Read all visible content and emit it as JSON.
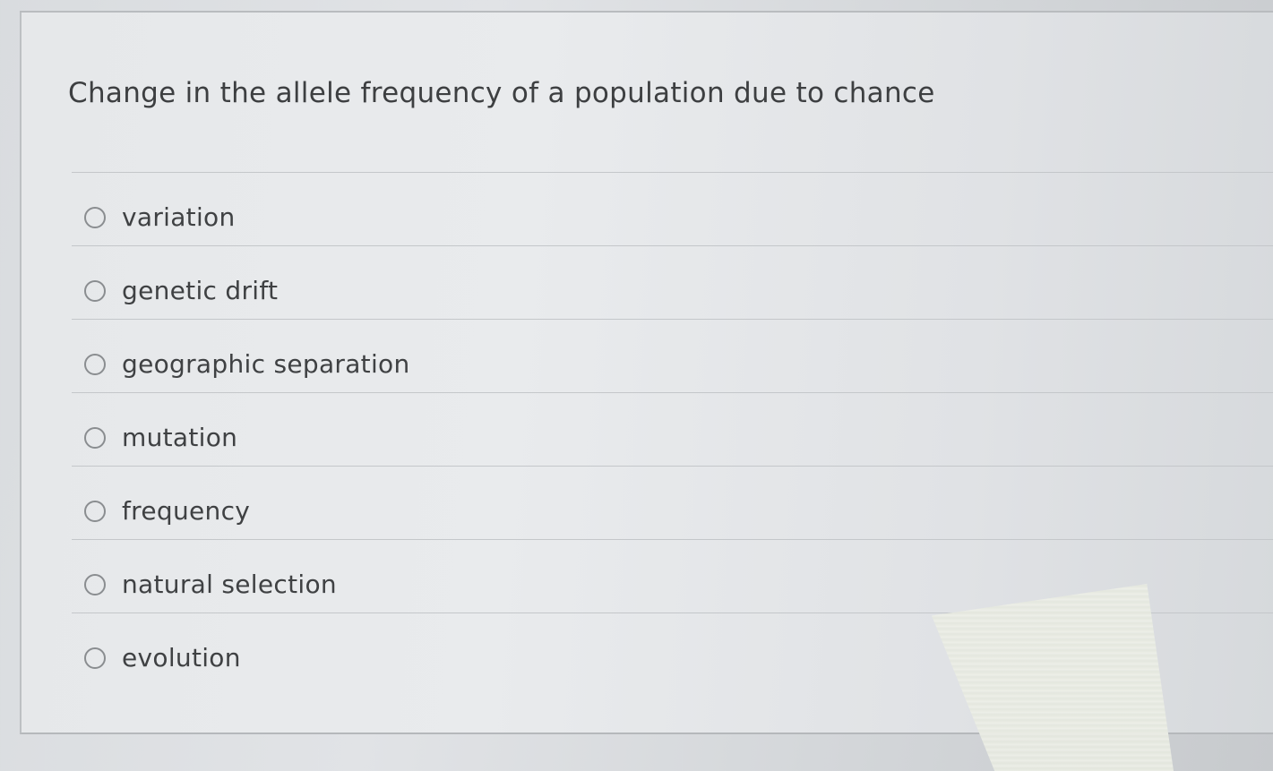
{
  "question": {
    "text": "Change in the allele frequency of a population due to chance"
  },
  "options": [
    {
      "label": "variation",
      "selected": false
    },
    {
      "label": "genetic drift",
      "selected": false
    },
    {
      "label": "geographic separation",
      "selected": false
    },
    {
      "label": "mutation",
      "selected": false
    },
    {
      "label": "frequency",
      "selected": false
    },
    {
      "label": "natural selection",
      "selected": false
    },
    {
      "label": "evolution",
      "selected": false
    }
  ]
}
